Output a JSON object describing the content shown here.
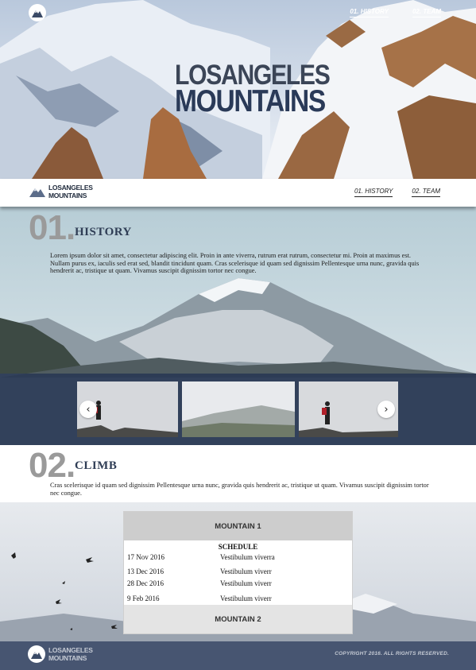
{
  "brand": {
    "line1": "LOSANGELES",
    "line2": "MOUNTAINS"
  },
  "hero": {
    "title_line1": "LOSANGELES",
    "title_line2": "MOUNTAINS",
    "nav": [
      "01. HISTORY",
      "02. TEAM"
    ]
  },
  "navbar": {
    "logo_line1": "LOSANGELES",
    "logo_line2": "MOUNTAINS",
    "nav": [
      "01. HISTORY",
      "02. TEAM"
    ]
  },
  "history": {
    "number": "01.",
    "title": "HISTORY",
    "body": "Lorem ipsum dolor sit amet, consectetur adipiscing elit. Proin in ante viverra, rutrum erat rutrum, consectetur mi. Proin at maximus est. Nullam purus ex, iaculis sed erat sed, blandit tincidunt quam. Cras scelerisque id quam sed dignissim Pellentesque urna nunc, gravida quis hendrerit ac, tristique ut quam. Vivamus suscipit dignissim tortor nec congue."
  },
  "gallery": {
    "prev_icon": "chevron-left-icon",
    "next_icon": "chevron-right-icon",
    "prev": "‹",
    "next": "›"
  },
  "climb": {
    "number": "02.",
    "title": "CLIMB",
    "body": "Cras scelerisque id quam sed dignissim Pellentesque urna nunc, gravida quis hendrerit ac, tristique ut quam. Vivamus suscipit dignissim tortor nec congue."
  },
  "schedule": {
    "mountain1": "MOUNTAIN 1",
    "heading": "SCHEDULE",
    "rows": [
      {
        "date": "17 Nov 2016",
        "name": "Vestibulum viverra"
      },
      {
        "date": "13 Dec 2016",
        "name": "Vestibulum viverr"
      },
      {
        "date": "28 Dec 2016",
        "name": "Vestibulum viverr"
      },
      {
        "date": "9 Feb 2016",
        "name": "Vestibulum viverr"
      }
    ],
    "mountain2": "MOUNTAIN 2"
  },
  "footer": {
    "logo_line1": "LOSANGELES",
    "logo_line2": "MOUNTAINS",
    "copyright": "COPYRIGHT 2016.  ALL RIGHTS RESERVED."
  },
  "colors": {
    "navy": "#2f3d55",
    "footer": "#475571",
    "gallery": "#2a3955"
  }
}
